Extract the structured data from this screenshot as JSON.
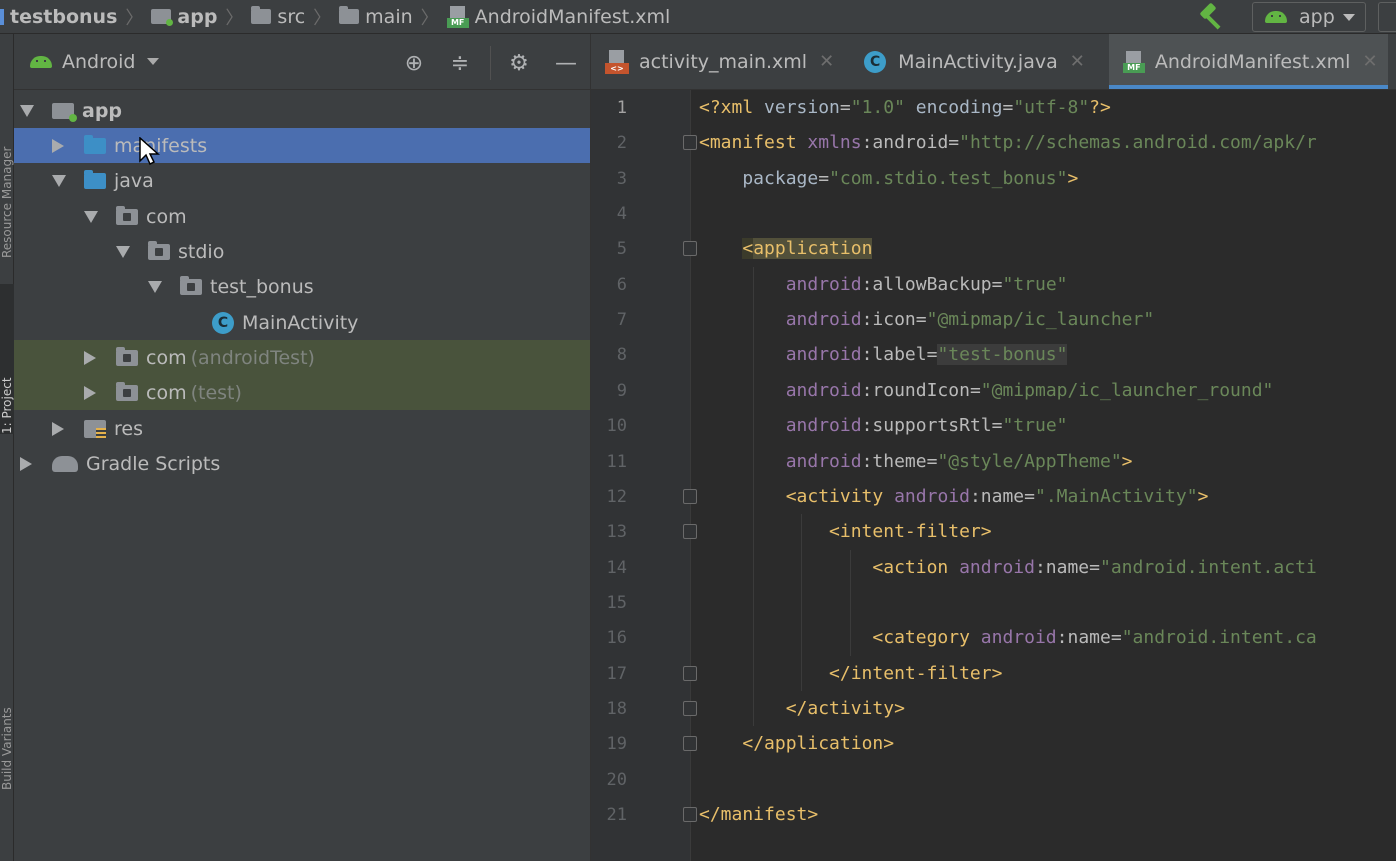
{
  "breadcrumb": {
    "items": [
      "testbonus",
      "app",
      "src",
      "main",
      "AndroidManifest.xml"
    ]
  },
  "run_config": {
    "label": "app"
  },
  "project_panel": {
    "view_label": "Android",
    "side_tabs": [
      "Resource Manager",
      "1: Project",
      "Build Variants"
    ],
    "tree": [
      {
        "label": "app",
        "suffix": "",
        "icon": "module-folder-icon"
      },
      {
        "label": "manifests",
        "suffix": "",
        "icon": "folder-icon"
      },
      {
        "label": "java",
        "suffix": "",
        "icon": "folder-icon"
      },
      {
        "label": "com",
        "suffix": "",
        "icon": "package-icon"
      },
      {
        "label": "stdio",
        "suffix": "",
        "icon": "package-icon"
      },
      {
        "label": "test_bonus",
        "suffix": "",
        "icon": "package-icon"
      },
      {
        "label": "MainActivity",
        "suffix": "",
        "icon": "class-icon"
      },
      {
        "label": "com",
        "suffix": "(androidTest)",
        "icon": "package-icon"
      },
      {
        "label": "com",
        "suffix": "(test)",
        "icon": "package-icon"
      },
      {
        "label": "res",
        "suffix": "",
        "icon": "res-folder-icon"
      },
      {
        "label": "Gradle Scripts",
        "suffix": "",
        "icon": "gradle-icon"
      }
    ]
  },
  "editor": {
    "tabs": [
      {
        "label": "activity_main.xml",
        "icon": "xml-file-icon",
        "active": false
      },
      {
        "label": "MainActivity.java",
        "icon": "class-icon",
        "active": false
      },
      {
        "label": "AndroidManifest.xml",
        "icon": "manifest-file-icon",
        "active": true
      }
    ],
    "line_numbers": [
      "1",
      "2",
      "3",
      "4",
      "5",
      "6",
      "7",
      "8",
      "9",
      "10",
      "11",
      "12",
      "13",
      "14",
      "15",
      "16",
      "17",
      "18",
      "19",
      "20",
      "21"
    ],
    "lines": [
      "<?xml version=\"1.0\" encoding=\"utf-8\"?>",
      "<manifest xmlns:android=\"http://schemas.android.com/apk/r",
      "    package=\"com.stdio.test_bonus\">",
      "",
      "    <application",
      "        android:allowBackup=\"true\"",
      "        android:icon=\"@mipmap/ic_launcher\"",
      "        android:label=\"test-bonus\"",
      "        android:roundIcon=\"@mipmap/ic_launcher_round\"",
      "        android:supportsRtl=\"true\"",
      "        android:theme=\"@style/AppTheme\">",
      "        <activity android:name=\".MainActivity\">",
      "            <intent-filter>",
      "                <action android:name=\"android.intent.acti",
      "",
      "                <category android:name=\"android.intent.ca",
      "            </intent-filter>",
      "        </activity>",
      "    </application>",
      "",
      "</manifest>"
    ]
  },
  "colors": {
    "tag": "#e8bf6a",
    "namespace": "#9876aa",
    "string": "#6a8759",
    "selection": "#4b6eaf",
    "test_row": "#49533c"
  }
}
